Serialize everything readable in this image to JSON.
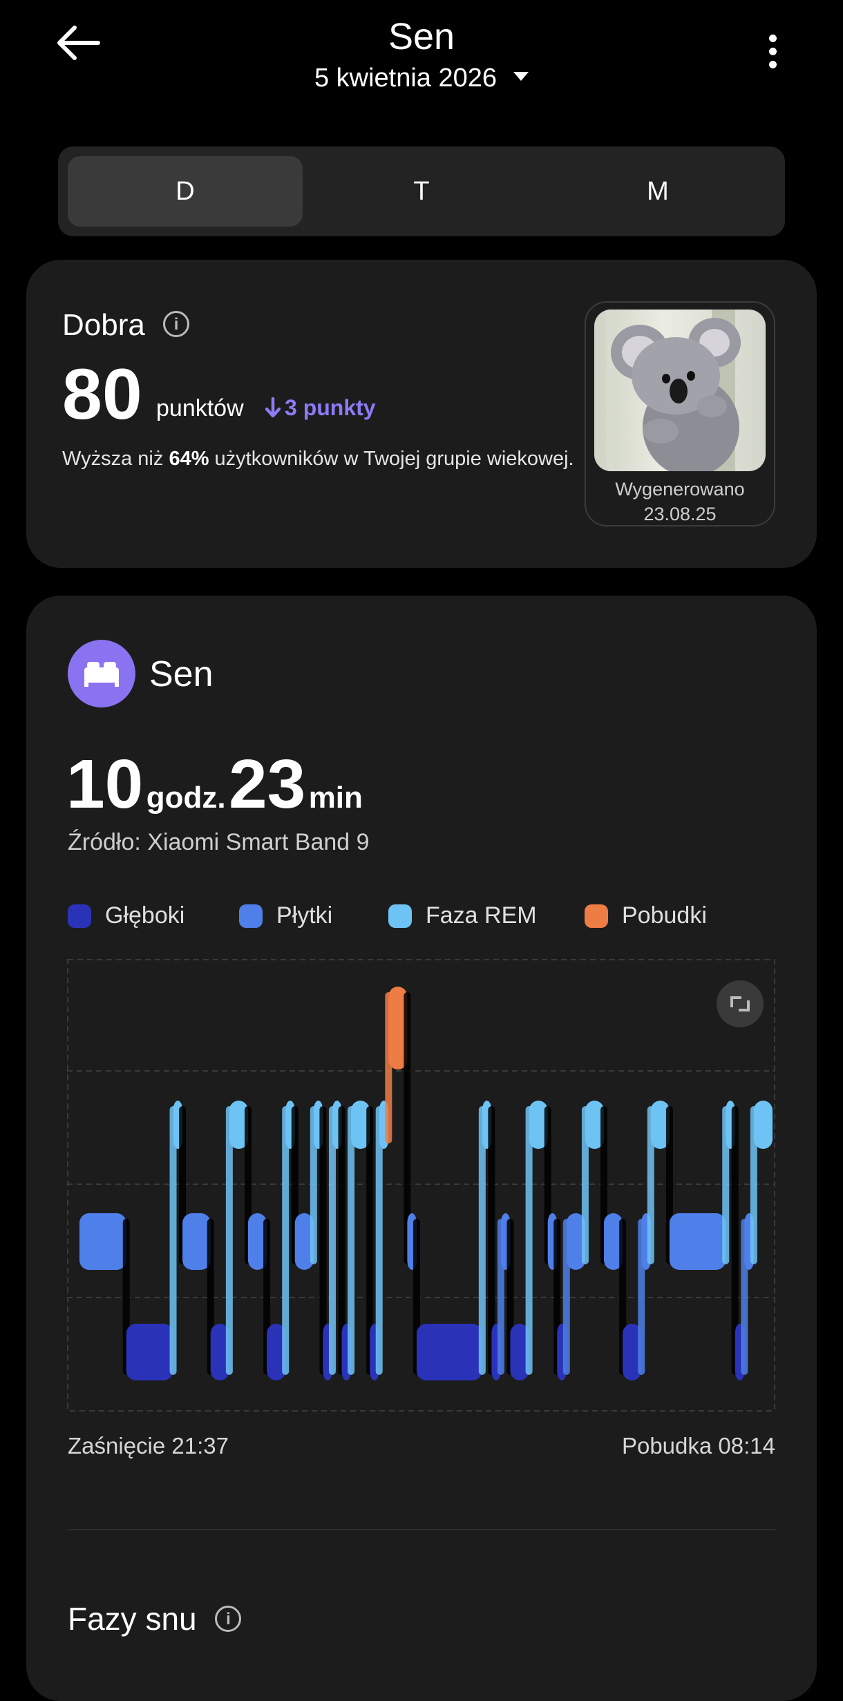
{
  "header": {
    "title": "Sen",
    "date": "5 kwietnia 2026"
  },
  "tabs": [
    "D",
    "T",
    "M"
  ],
  "active_tab": "D",
  "score": {
    "label": "Dobra",
    "value": "80",
    "unit": "punktów",
    "delta": "3 punkty",
    "delta_direction": "down",
    "desc_prefix": "Wyższa niż ",
    "desc_percent": "64%",
    "desc_suffix": " użytkowników w Twojej grupie wiekowej.",
    "avatar_caption_line1": "Wygenerowano",
    "avatar_caption_line2": "23.08.25"
  },
  "sleep": {
    "title": "Sen",
    "hours": "10",
    "hours_unit": "godz.",
    "minutes": "23",
    "minutes_unit": "min",
    "source": "Źródło: Xiaomi Smart Band 9",
    "legend": [
      {
        "label": "Głęboki",
        "color": "#2a33b8"
      },
      {
        "label": "Płytki",
        "color": "#4f7fe8"
      },
      {
        "label": "Faza REM",
        "color": "#6ec3f5"
      },
      {
        "label": "Pobudki",
        "color": "#ee7c45"
      }
    ],
    "sleep_start": "Zaśnięcie 21:37",
    "wake_end": "Pobudka 08:14",
    "phases_title": "Fazy snu"
  },
  "colors": {
    "accent": "#8a73f0",
    "deep": "#2a33b8",
    "light": "#4f7fe8",
    "rem": "#6ec3f5",
    "awake": "#ee7c45"
  },
  "chart_data": {
    "type": "hypnogram",
    "levels": [
      "Pobudki",
      "Faza REM",
      "Płytki",
      "Głęboki"
    ],
    "stages": [
      {
        "stage": "Płytki",
        "duration": 5
      },
      {
        "stage": "Głęboki",
        "duration": 5
      },
      {
        "stage": "Faza REM",
        "duration": 1
      },
      {
        "stage": "Płytki",
        "duration": 3
      },
      {
        "stage": "Głęboki",
        "duration": 2
      },
      {
        "stage": "Faza REM",
        "duration": 2
      },
      {
        "stage": "Płytki",
        "duration": 2
      },
      {
        "stage": "Głęboki",
        "duration": 2
      },
      {
        "stage": "Faza REM",
        "duration": 1
      },
      {
        "stage": "Płytki",
        "duration": 2
      },
      {
        "stage": "Faza REM",
        "duration": 1
      },
      {
        "stage": "Głęboki",
        "duration": 1
      },
      {
        "stage": "Faza REM",
        "duration": 1
      },
      {
        "stage": "Głęboki",
        "duration": 1
      },
      {
        "stage": "Faza REM",
        "duration": 2
      },
      {
        "stage": "Głęboki",
        "duration": 1
      },
      {
        "stage": "Faza REM",
        "duration": 1
      },
      {
        "stage": "Pobudki",
        "duration": 2
      },
      {
        "stage": "Płytki",
        "duration": 1
      },
      {
        "stage": "Głęboki",
        "duration": 7
      },
      {
        "stage": "Faza REM",
        "duration": 1
      },
      {
        "stage": "Głęboki",
        "duration": 1
      },
      {
        "stage": "Płytki",
        "duration": 1
      },
      {
        "stage": "Głęboki",
        "duration": 2
      },
      {
        "stage": "Faza REM",
        "duration": 2
      },
      {
        "stage": "Płytki",
        "duration": 1
      },
      {
        "stage": "Głęboki",
        "duration": 1
      },
      {
        "stage": "Płytki",
        "duration": 2
      },
      {
        "stage": "Faza REM",
        "duration": 2
      },
      {
        "stage": "Płytki",
        "duration": 2
      },
      {
        "stage": "Głęboki",
        "duration": 2
      },
      {
        "stage": "Płytki",
        "duration": 1
      },
      {
        "stage": "Faza REM",
        "duration": 2
      },
      {
        "stage": "Płytki",
        "duration": 6
      },
      {
        "stage": "Faza REM",
        "duration": 1
      },
      {
        "stage": "Głęboki",
        "duration": 1
      },
      {
        "stage": "Płytki",
        "duration": 1
      },
      {
        "stage": "Faza REM",
        "duration": 2
      }
    ]
  }
}
